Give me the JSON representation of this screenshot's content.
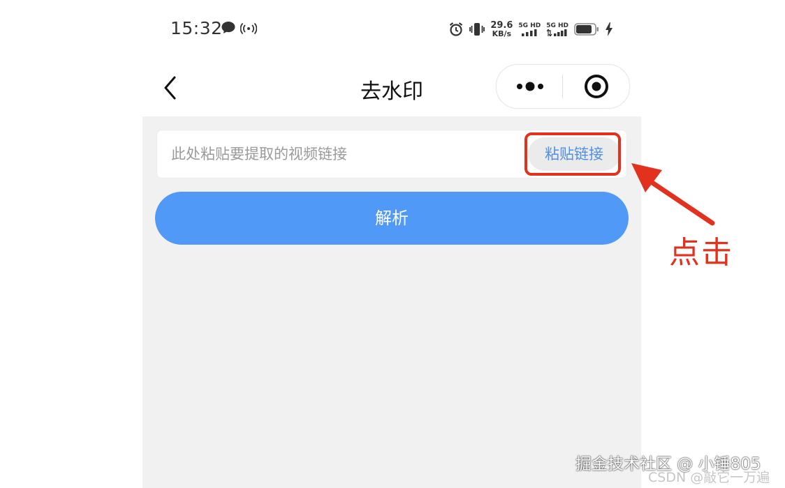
{
  "status_bar": {
    "time": "15:32",
    "net_speed_value": "29.6",
    "net_speed_unit": "KB/s",
    "sim1_label": "5G HD",
    "sim2_label": "5G HD"
  },
  "nav": {
    "title": "去水印"
  },
  "form": {
    "input_placeholder": "此处粘贴要提取的视频链接",
    "paste_button_label": "粘贴链接",
    "parse_button_label": "解析"
  },
  "annotation": {
    "click_text": "点击",
    "highlight_color": "#e2311d"
  },
  "watermarks": {
    "juejin": "掘金技术社区 @ 小锤805",
    "csdn": "CSDN @敲它一万遍"
  },
  "colors": {
    "primary_button": "#5199f7",
    "paste_text": "#4f8fe6",
    "content_bg": "#f1f1f1"
  }
}
